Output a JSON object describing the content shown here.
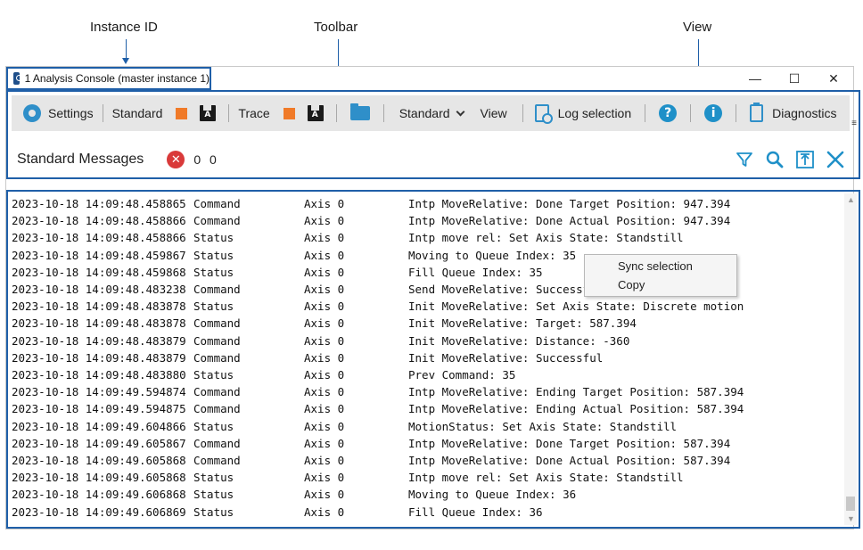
{
  "annotations": {
    "instance_id": "Instance ID",
    "toolbar": "Toolbar",
    "view": "View"
  },
  "window": {
    "title": "1 Analysis Console (master instance 1)",
    "controls": [
      "—",
      "☐",
      "✕"
    ]
  },
  "toolbar": {
    "settings": "Settings",
    "standard": "Standard",
    "trace": "Trace",
    "standard_dropdown": "Standard",
    "view": "View",
    "log_selection": "Log selection",
    "help_glyph": "?",
    "info_glyph": "i",
    "diagnostics": "Diagnostics",
    "overflow": "≡"
  },
  "messages_bar": {
    "title": "Standard Messages",
    "error_glyph": "✕",
    "counts": "0 0"
  },
  "log": {
    "rows": [
      {
        "time": "2023-10-18 14:09:48.458865",
        "type": "Command",
        "axis": "Axis 0",
        "msg": "Intp MoveRelative: Done Target Position: 947.394"
      },
      {
        "time": "2023-10-18 14:09:48.458866",
        "type": "Command",
        "axis": "Axis 0",
        "msg": "Intp MoveRelative: Done Actual Position: 947.394"
      },
      {
        "time": "2023-10-18 14:09:48.458866",
        "type": "Status",
        "axis": "Axis 0",
        "msg": "Intp move rel: Set Axis State: Standstill"
      },
      {
        "time": "2023-10-18 14:09:48.459867",
        "type": "Status",
        "axis": "Axis 0",
        "msg": "Moving to Queue Index: 35"
      },
      {
        "time": "2023-10-18 14:09:48.459868",
        "type": "Status",
        "axis": "Axis 0",
        "msg": "Fill Queue Index: 35"
      },
      {
        "time": "2023-10-18 14:09:48.483238",
        "type": "Command",
        "axis": "Axis 0",
        "msg": "Send MoveRelative: Successful"
      },
      {
        "time": "2023-10-18 14:09:48.483878",
        "type": "Status",
        "axis": "Axis 0",
        "msg": "Init MoveRelative: Set Axis State: Discrete motion"
      },
      {
        "time": "2023-10-18 14:09:48.483878",
        "type": "Command",
        "axis": "Axis 0",
        "msg": "Init MoveRelative: Target: 587.394"
      },
      {
        "time": "2023-10-18 14:09:48.483879",
        "type": "Command",
        "axis": "Axis 0",
        "msg": "Init MoveRelative: Distance: -360"
      },
      {
        "time": "2023-10-18 14:09:48.483879",
        "type": "Command",
        "axis": "Axis 0",
        "msg": "Init MoveRelative: Successful"
      },
      {
        "time": "2023-10-18 14:09:48.483880",
        "type": "Status",
        "axis": "Axis 0",
        "msg": "Prev Command: 35"
      },
      {
        "time": "2023-10-18 14:09:49.594874",
        "type": "Command",
        "axis": "Axis 0",
        "msg": "Intp MoveRelative: Ending Target Position: 587.394"
      },
      {
        "time": "2023-10-18 14:09:49.594875",
        "type": "Command",
        "axis": "Axis 0",
        "msg": "Intp MoveRelative: Ending Actual Position: 587.394"
      },
      {
        "time": "2023-10-18 14:09:49.604866",
        "type": "Status",
        "axis": "Axis 0",
        "msg": "MotionStatus: Set Axis State: Standstill"
      },
      {
        "time": "2023-10-18 14:09:49.605867",
        "type": "Command",
        "axis": "Axis 0",
        "msg": "Intp MoveRelative: Done Target Position: 587.394"
      },
      {
        "time": "2023-10-18 14:09:49.605868",
        "type": "Command",
        "axis": "Axis 0",
        "msg": "Intp MoveRelative: Done Actual Position: 587.394"
      },
      {
        "time": "2023-10-18 14:09:49.605868",
        "type": "Status",
        "axis": "Axis 0",
        "msg": "Intp move rel: Set Axis State: Standstill"
      },
      {
        "time": "2023-10-18 14:09:49.606868",
        "type": "Status",
        "axis": "Axis 0",
        "msg": "Moving to Queue Index: 36"
      },
      {
        "time": "2023-10-18 14:09:49.606869",
        "type": "Status",
        "axis": "Axis 0",
        "msg": "Fill Queue Index: 36"
      }
    ]
  },
  "context_menu": {
    "items": [
      "Sync selection",
      "Copy"
    ]
  },
  "colors": {
    "accent": "#1f5fa8",
    "icon_blue": "#1f90c8",
    "orange": "#f07a28",
    "error_red": "#d93a3a",
    "toolbar_bg": "#e6e6e6"
  }
}
